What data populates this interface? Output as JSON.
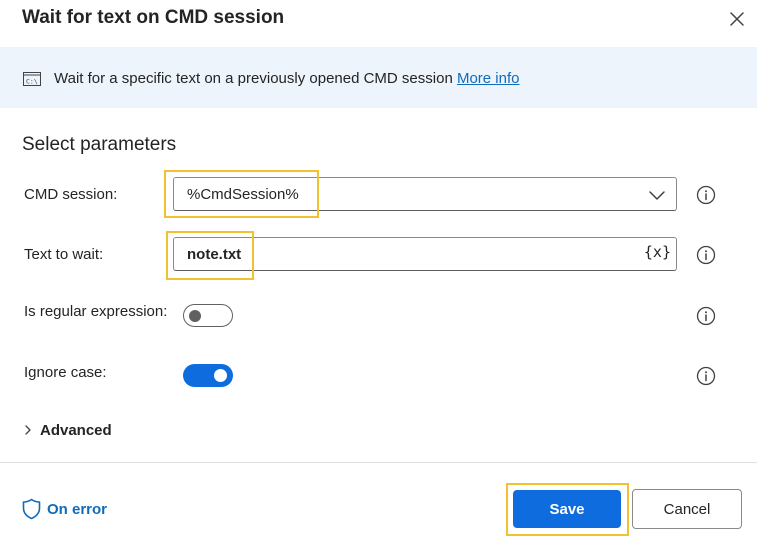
{
  "dialog": {
    "title": "Wait for text on CMD session",
    "close_icon": "close-icon"
  },
  "banner": {
    "icon": "cmd-icon",
    "text": "Wait for a specific text on a previously opened CMD session",
    "link": "More info"
  },
  "parameters": {
    "section_title": "Select parameters",
    "cmd_session": {
      "label": "CMD session:",
      "value": "%CmdSession%"
    },
    "text_to_wait": {
      "label": "Text to wait:",
      "value": "note.txt",
      "variable_icon": "{x}"
    },
    "is_regular_expression": {
      "label": "Is regular expression:",
      "enabled": false
    },
    "ignore_case": {
      "label": "Ignore case:",
      "enabled": true
    },
    "advanced": {
      "label": "Advanced"
    }
  },
  "footer": {
    "on_error": "On error",
    "save": "Save",
    "cancel": "Cancel"
  },
  "colors": {
    "accent": "#0f6cde",
    "link": "#0f6cbd",
    "highlight": "#f2c12e",
    "banner_bg": "#eef4fb"
  }
}
